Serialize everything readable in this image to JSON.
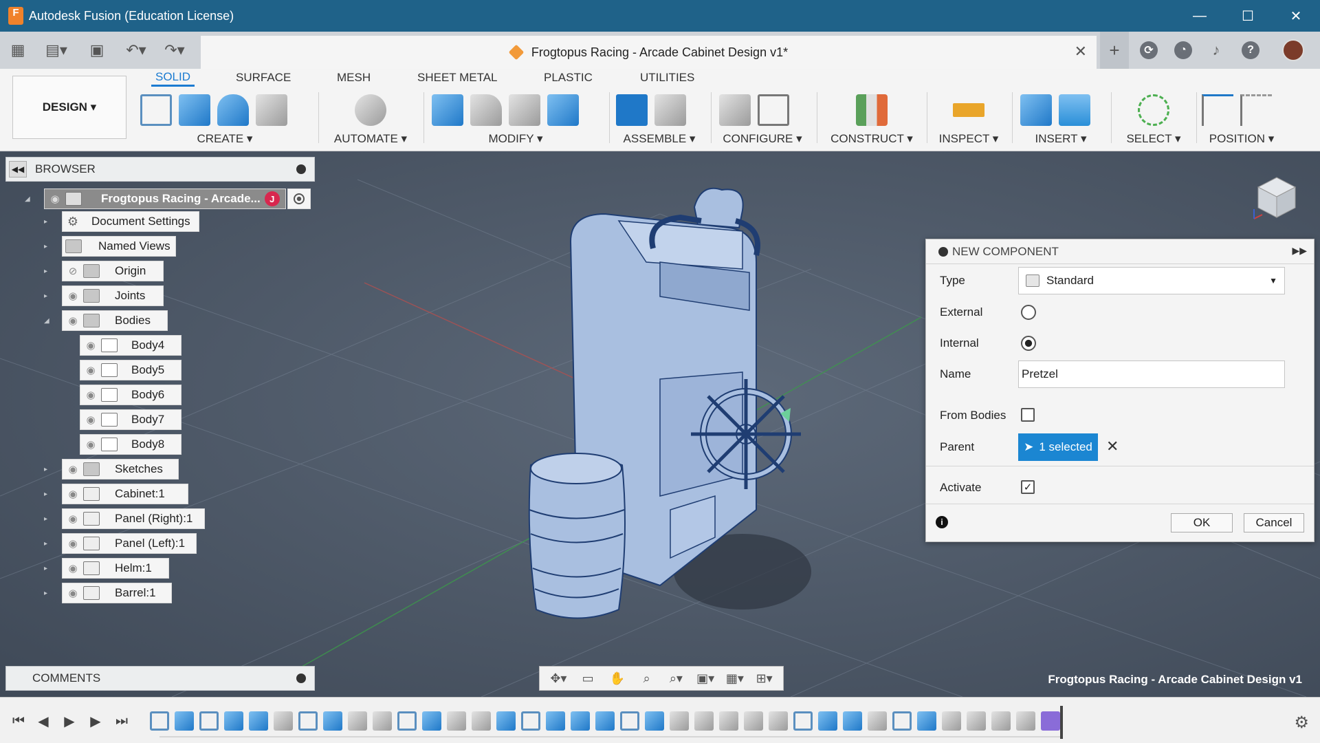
{
  "window": {
    "app_title": "Autodesk Fusion (Education License)",
    "logo_letter": "F",
    "minimize": "—",
    "maximize": "☐",
    "close": "✕"
  },
  "doc_tab": {
    "title": "Frogtopus Racing - Arcade Cabinet Design v1*",
    "close": "✕"
  },
  "toolbar": {
    "workspace": "DESIGN ▾",
    "tabs": [
      "SOLID",
      "SURFACE",
      "MESH",
      "SHEET METAL",
      "PLASTIC",
      "UTILITIES"
    ],
    "active_tab": "SOLID",
    "groups": [
      "CREATE ▾",
      "AUTOMATE ▾",
      "MODIFY ▾",
      "ASSEMBLE ▾",
      "CONFIGURE ▾",
      "CONSTRUCT ▾",
      "INSPECT ▾",
      "INSERT ▾",
      "SELECT ▾",
      "POSITION ▾"
    ]
  },
  "browser": {
    "title": "BROWSER",
    "root": "Frogtopus Racing - Arcade...",
    "root_badge": "J",
    "items": {
      "document_settings": "Document Settings",
      "named_views": "Named Views",
      "origin": "Origin",
      "joints": "Joints",
      "bodies": "Bodies",
      "body4": "Body4",
      "body5": "Body5",
      "body6": "Body6",
      "body7": "Body7",
      "body8": "Body8",
      "sketches": "Sketches",
      "cabinet": "Cabinet:1",
      "panel_right": "Panel (Right):1",
      "panel_left": "Panel (Left):1",
      "helm": "Helm:1",
      "barrel": "Barrel:1"
    }
  },
  "comments": {
    "title": "COMMENTS"
  },
  "viewport": {
    "model_title": "Frogtopus Racing - Arcade Cabinet Design v1"
  },
  "new_component": {
    "title": "NEW COMPONENT",
    "type_label": "Type",
    "type_value": "Standard",
    "external_label": "External",
    "internal_label": "Internal",
    "selected_option": "Internal",
    "name_label": "Name",
    "name_value": "Pretzel",
    "from_bodies_label": "From Bodies",
    "from_bodies_checked": false,
    "parent_label": "Parent",
    "parent_value": "1 selected",
    "activate_label": "Activate",
    "activate_checked": true,
    "ok": "OK",
    "cancel": "Cancel"
  },
  "colors": {
    "titlebar": "#1f6289",
    "accent": "#1b86d2",
    "tab_active": "#1b7bd1"
  }
}
